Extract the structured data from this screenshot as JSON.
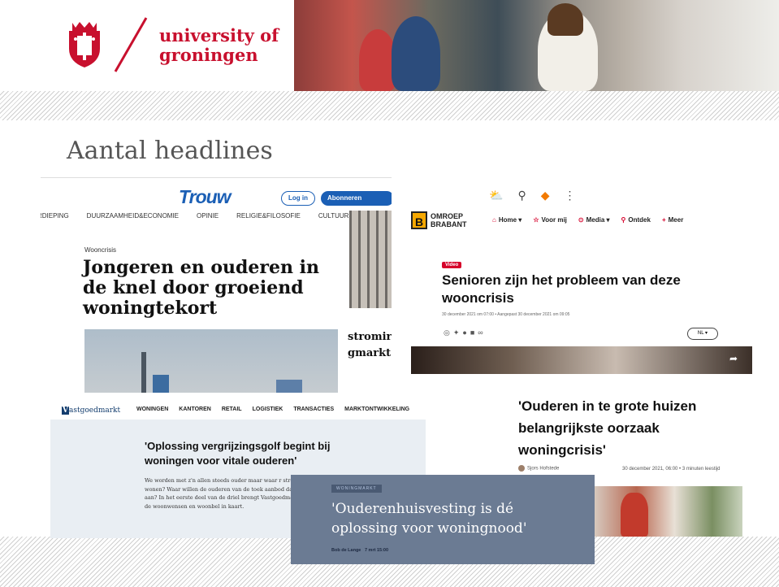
{
  "logo": {
    "line1": "university of",
    "line2": "groningen"
  },
  "slide_title": "Aantal headlines",
  "trouw": {
    "logo": "Trouw",
    "login": "Log in",
    "subscribe": "Abonneren",
    "nav": [
      "RDIEPING",
      "DUURZAAMHEID&ECONOMIE",
      "OPINIE",
      "RELIGIE&FILOSOFIE",
      "CULTUUR&M"
    ],
    "kicker": "Wooncrisis",
    "headline": "Jongeren en ouderen in de knel door groeiend woningtekort",
    "fragment1": "stromir",
    "fragment2": "gmarkt"
  },
  "omroep": {
    "brand_letter": "B",
    "brand_line1": "OMROEP",
    "brand_line2": "BRABANT",
    "nav": [
      {
        "icon": "⌂",
        "label": "Home ▾"
      },
      {
        "icon": "☆",
        "label": "Voor mij"
      },
      {
        "icon": "⊙",
        "label": "Media ▾"
      },
      {
        "icon": "⚲",
        "label": "Ontdek"
      },
      {
        "icon": "+",
        "label": "Meer"
      }
    ],
    "badge": "Video",
    "headline": "Senioren zijn het probleem van deze wooncrisis",
    "meta": "30 december 2021 om 07:00 • Aangepast 30 december 2021 om 09:05",
    "lang": "NL ▾"
  },
  "vastgoed": {
    "logo_initial": "V",
    "logo_rest": "astgoedmarkt",
    "nav": [
      "WONINGEN",
      "KANTOREN",
      "RETAIL",
      "LOGISTIEK",
      "TRANSACTIES",
      "MARKTONTWIKKELING"
    ],
    "headline": "'Oplossing vergrijzingsgolf begint bij woningen voor vitale ouderen'",
    "body": "We worden met z'n allen steeds ouder maar waar r straks wonen? Waar willen de ouderen van de toek aanbod daarop aan? In het eerste deel van de driel brengt Vastgoedmarkt de woonwensen en woonbel in kaart."
  },
  "nd": {
    "headline": "'Ouderen in te grote huizen belangrijkste oorzaak woningcrisis'",
    "author": "Sjors Hofstede",
    "date": "30 december 2021, 06:00 • 3 minuten leestijd"
  },
  "woning": {
    "tag": "WONINGMARKT",
    "headline": "'Ouderenhuisvesting is dé oplossing voor woningnood'",
    "author": "Bob de Lange",
    "time": "7 mrt  15:00"
  }
}
